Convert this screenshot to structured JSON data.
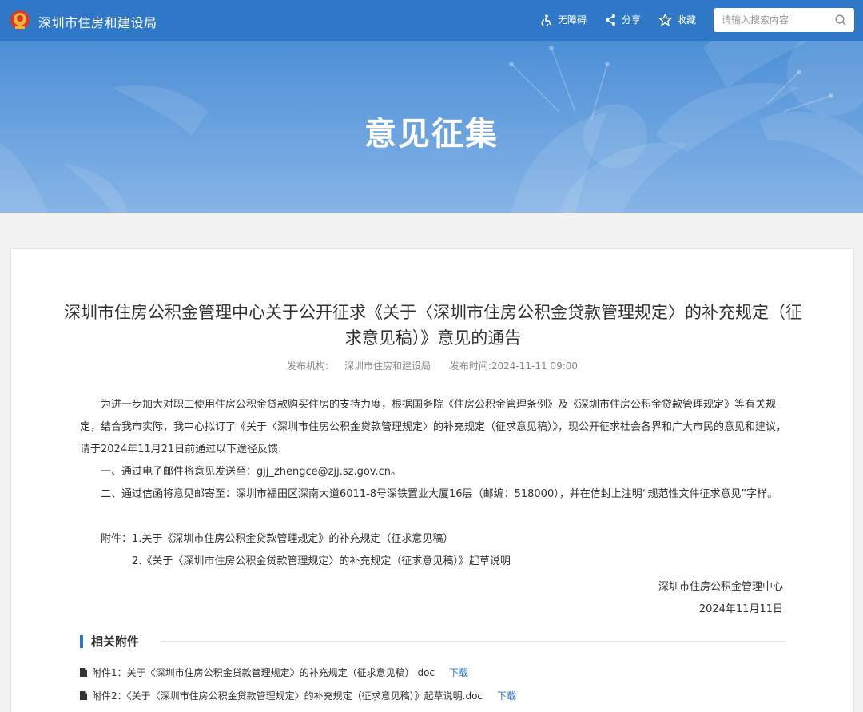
{
  "header": {
    "site_name": "深圳市住房和建设局",
    "tools": [
      {
        "label": "无障碍",
        "icon": "accessibility-icon"
      },
      {
        "label": "分享",
        "icon": "share-icon"
      },
      {
        "label": "收藏",
        "icon": "star-icon"
      }
    ],
    "search": {
      "placeholder": "请输入搜索内容",
      "icon": "search-icon"
    }
  },
  "banner": {
    "title": "意见征集"
  },
  "article": {
    "title": "深圳市住房公积金管理中心关于公开征求《关于〈深圳市住房公积金贷款管理规定〉的补充规定（征求意见稿）》意见的通告",
    "meta": {
      "publisher_label": "发布机构:",
      "publisher": "深圳市住房和建设局",
      "time_label": "发布时间:",
      "time": "2024-11-11 09:00"
    },
    "paragraphs": [
      "为进一步加大对职工使用住房公积金贷款购买住房的支持力度，根据国务院《住房公积金管理条例》及《深圳市住房公积金贷款管理规定》等有关规定，结合我市实际，我中心拟订了《关于〈深圳市住房公积金贷款管理规定〉的补充规定（征求意见稿）》，现公开征求社会各界和广大市民的意见和建议，请于2024年11月21日前通过以下途径反馈:",
      "一、通过电子邮件将意见发送至：gjj_zhengce@zjj.sz.gov.cn。",
      "二、通过信函将意见邮寄至：深圳市福田区深南大道6011-8号深铁置业大厦16层（邮编：518000），并在信封上注明“规范性文件征求意见”字样。",
      "附件：1.关于《深圳市住房公积金贷款管理规定》的补充规定（征求意见稿）"
    ],
    "attachment_line2": "2.《关于〈深圳市住房公积金贷款管理规定〉的补充规定（征求意见稿）》起草说明",
    "signature": "深圳市住房公积金管理中心",
    "date": "2024年11月11日"
  },
  "related": {
    "title": "相关附件",
    "download_label": "下载",
    "files": [
      {
        "name": "附件1：关于《深圳市住房公积金贷款管理规定》的补充规定（征求意见稿）.doc"
      },
      {
        "name": "附件2：《关于〈深圳市住房公积金贷款管理规定〉的补充规定（征求意见稿）》起草说明.doc"
      }
    ]
  },
  "colors": {
    "topbar": "#2f78c8",
    "banner": "#5f9bdc",
    "link": "#2f78c8",
    "accent_bar": "#2f78c8"
  }
}
